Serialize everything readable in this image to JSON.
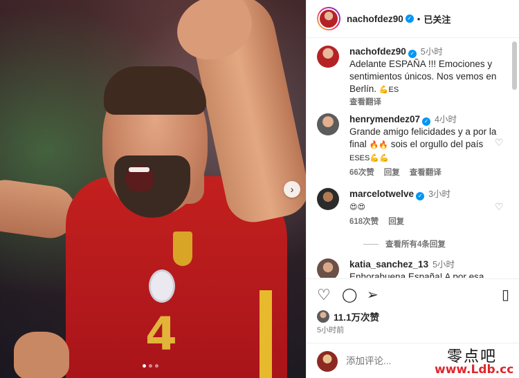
{
  "post": {
    "carousel_next": "›",
    "dots": 3
  },
  "header": {
    "username": "nachofdez90",
    "separator": "•",
    "follow_label": "已关注"
  },
  "comments": [
    {
      "username": "nachofdez90",
      "verified": true,
      "time": "5小时",
      "text": "Adelante ESPAÑA !!! Emociones y sentimientos únicos. Nos vemos en Berlín.",
      "emoji": "💪ES",
      "translate": "查看翻译"
    },
    {
      "username": "henrymendez07",
      "verified": true,
      "time": "4小时",
      "text": "Grande amigo felicidades y a por la final",
      "emoji_mid": "🔥🔥",
      "text2": "sois el orgullo del país",
      "emoji": "ESES💪💪",
      "likes": "66次赞",
      "reply": "回复",
      "translate": "查看翻译"
    },
    {
      "username": "marcelotwelve",
      "verified": true,
      "time": "3小时",
      "emoji": "😍😍",
      "likes": "618次赞",
      "reply": "回复"
    },
    {
      "view_replies": "查看所有4条回复"
    },
    {
      "username": "katia_sanchez_13",
      "time": "5小时",
      "text": "Enhorabuena España! A por esa"
    }
  ],
  "actions": {
    "like_icon": "♡",
    "comment_icon": "◯",
    "share_icon": "➢",
    "save_icon": "▯",
    "likes_count": "11.1万次赞",
    "posted_ago": "5小时前",
    "add_comment_placeholder": "添加评论..."
  },
  "watermark": {
    "chinese": "零点吧",
    "url": "www.Ldb.cc"
  },
  "colors": {
    "verified": "#0095f6",
    "secondary_text": "#737373",
    "watermark_url": "#e0262b"
  }
}
